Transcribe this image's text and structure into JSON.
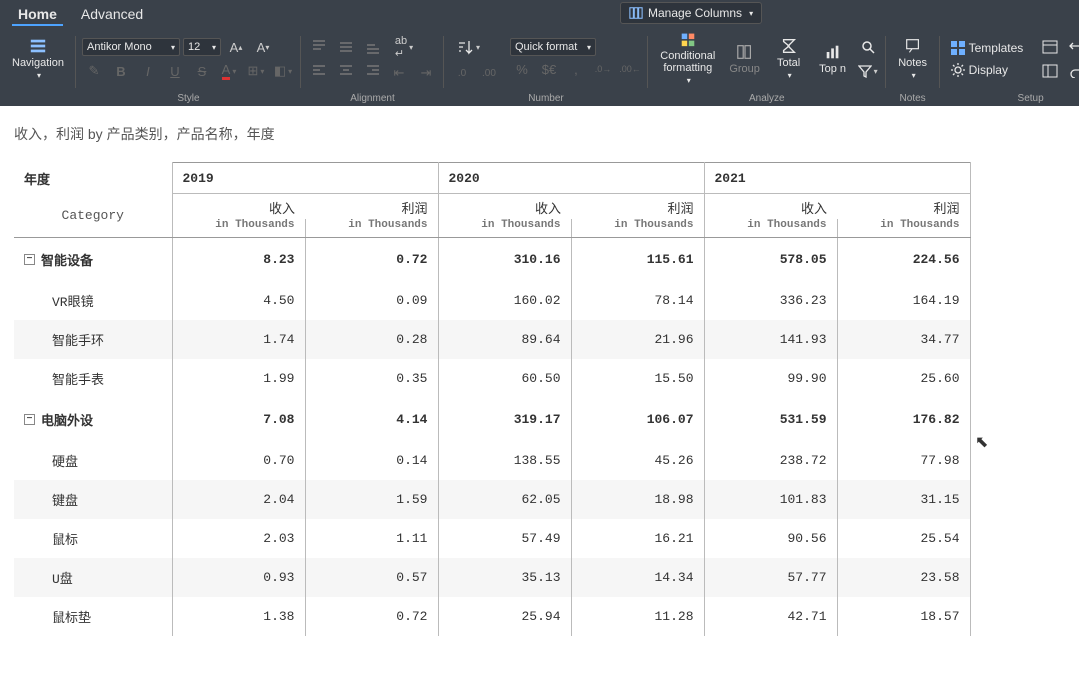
{
  "tabs": {
    "home": "Home",
    "advanced": "Advanced"
  },
  "manage_columns": "Manage Columns",
  "ribbon": {
    "navigation": "Navigation",
    "font_name": "Antikor Mono",
    "font_size": "12",
    "quick_format": "Quick format",
    "cond_fmt_l1": "Conditional",
    "cond_fmt_l2": "formatting",
    "group": "Group",
    "total": "Total",
    "topn": "Top n",
    "notes": "Notes",
    "templates": "Templates",
    "display": "Display",
    "grp_style": "Style",
    "grp_align": "Alignment",
    "grp_number": "Number",
    "grp_analyze": "Analyze",
    "grp_notes": "Notes",
    "grp_setup": "Setup"
  },
  "title": "收入，利润 by 产品类别，产品名称，年度",
  "table": {
    "year_label": "年度",
    "category_label": "Category",
    "years": [
      "2019",
      "2020",
      "2021"
    ],
    "measures": [
      {
        "name": "收入",
        "unit": "in Thousands"
      },
      {
        "name": "利润",
        "unit": "in Thousands"
      }
    ],
    "groups": [
      {
        "category": "智能设备",
        "totals": [
          "8.23",
          "0.72",
          "310.16",
          "115.61",
          "578.05",
          "224.56"
        ],
        "items": [
          {
            "name": "VR眼镜",
            "vals": [
              "4.50",
              "0.09",
              "160.02",
              "78.14",
              "336.23",
              "164.19"
            ]
          },
          {
            "name": "智能手环",
            "vals": [
              "1.74",
              "0.28",
              "89.64",
              "21.96",
              "141.93",
              "34.77"
            ]
          },
          {
            "name": "智能手表",
            "vals": [
              "1.99",
              "0.35",
              "60.50",
              "15.50",
              "99.90",
              "25.60"
            ]
          }
        ]
      },
      {
        "category": "电脑外设",
        "totals": [
          "7.08",
          "4.14",
          "319.17",
          "106.07",
          "531.59",
          "176.82"
        ],
        "items": [
          {
            "name": "硬盘",
            "vals": [
              "0.70",
              "0.14",
              "138.55",
              "45.26",
              "238.72",
              "77.98"
            ]
          },
          {
            "name": "键盘",
            "vals": [
              "2.04",
              "1.59",
              "62.05",
              "18.98",
              "101.83",
              "31.15"
            ]
          },
          {
            "name": "鼠标",
            "vals": [
              "2.03",
              "1.11",
              "57.49",
              "16.21",
              "90.56",
              "25.54"
            ]
          },
          {
            "name": "U盘",
            "vals": [
              "0.93",
              "0.57",
              "35.13",
              "14.34",
              "57.77",
              "23.58"
            ]
          },
          {
            "name": "鼠标垫",
            "vals": [
              "1.38",
              "0.72",
              "25.94",
              "11.28",
              "42.71",
              "18.57"
            ]
          }
        ]
      }
    ]
  }
}
